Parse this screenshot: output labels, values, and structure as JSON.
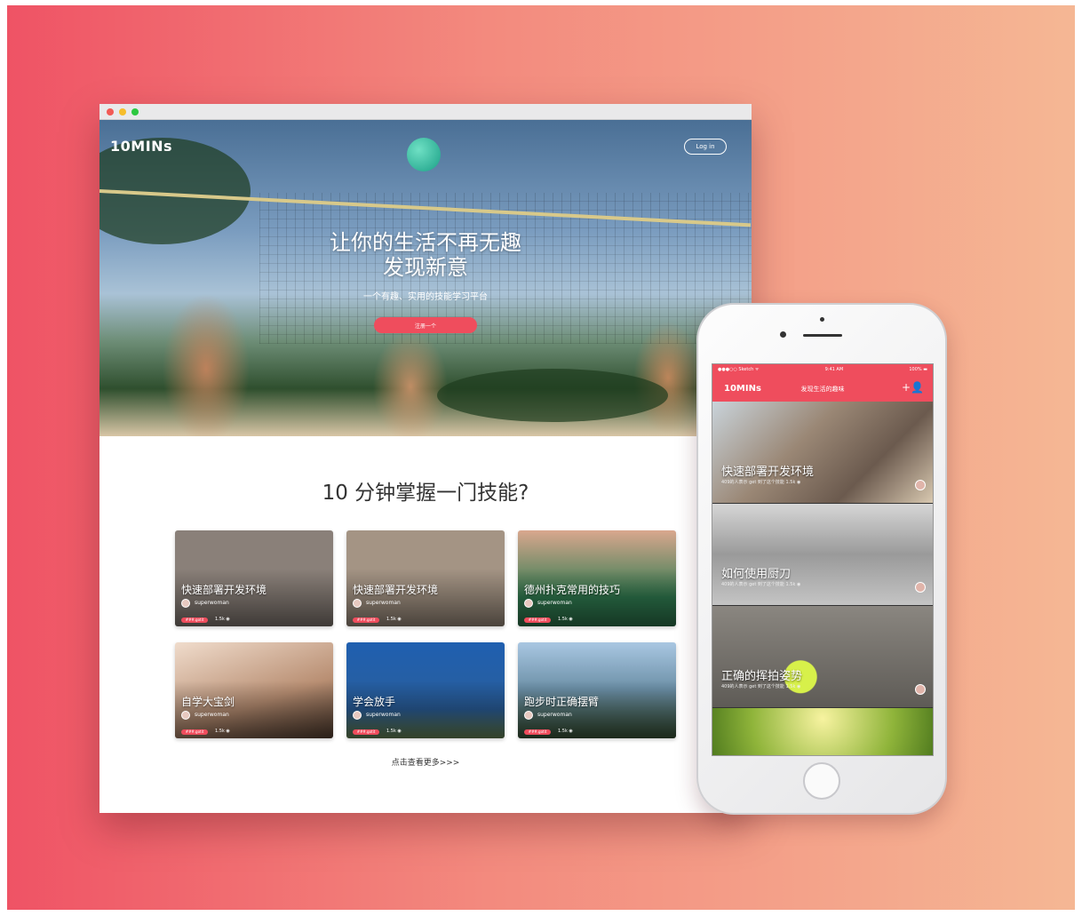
{
  "website": {
    "logo": "10MINs",
    "login_label": "Log in",
    "hero_title_line1": "让你的生活不再无趣",
    "hero_title_line2": "发现新意",
    "hero_subtitle": "一个有趣、实用的技能学习平台",
    "cta_label": "注册一个",
    "section_title": "10 分钟掌握一门技能?",
    "more_link": "点击查看更多>>>",
    "cards": [
      {
        "title": "快速部署开发环境",
        "author": "superwoman",
        "badge": "###.gotit",
        "stat": "1.5k ◉",
        "color": "#8a8079"
      },
      {
        "title": "快速部署开发环境",
        "author": "superwoman",
        "badge": "###.gotit",
        "stat": "1.5k ◉",
        "color": "#a49484"
      },
      {
        "title": "德州扑克常用的技巧",
        "author": "superwoman",
        "badge": "###.gotit",
        "stat": "1.5k ◉",
        "color": "#2f7a4f"
      },
      {
        "title": "自学大宝剑",
        "author": "superwoman",
        "badge": "###.gotit",
        "stat": "1.5k ◉",
        "color": "#b98f73"
      },
      {
        "title": "学会放手",
        "author": "superwoman",
        "badge": "###.gotit",
        "stat": "1.5k ◉",
        "color": "#2a5f9c"
      },
      {
        "title": "跑步时正确摆臂",
        "author": "superwoman",
        "badge": "###.gotit",
        "stat": "1.5k ◉",
        "color": "#5b7e8f"
      }
    ]
  },
  "phone": {
    "status_left": "●●●○○ Sketch ᯤ",
    "status_time": "9:41 AM",
    "status_right": "100% ▬",
    "nav_logo": "10MINs",
    "nav_title": "发现生活的趣味",
    "nav_icon": "+👤",
    "items": [
      {
        "title": "快速部署开发环境",
        "meta": "409的人表示 get 到了这个技能   1.5k ◉",
        "color": "#6b5a4e"
      },
      {
        "title": "如何使用厨刀",
        "meta": "409的人表示 get 到了这个技能   1.5k ◉",
        "color": "#9a9a9a"
      },
      {
        "title": "正确的挥拍姿势",
        "meta": "409的人表示 get 到了这个技能   1.5k ◉",
        "color": "#7d7a72"
      },
      {
        "title": "",
        "meta": "",
        "color": "#8fb43a"
      }
    ]
  }
}
